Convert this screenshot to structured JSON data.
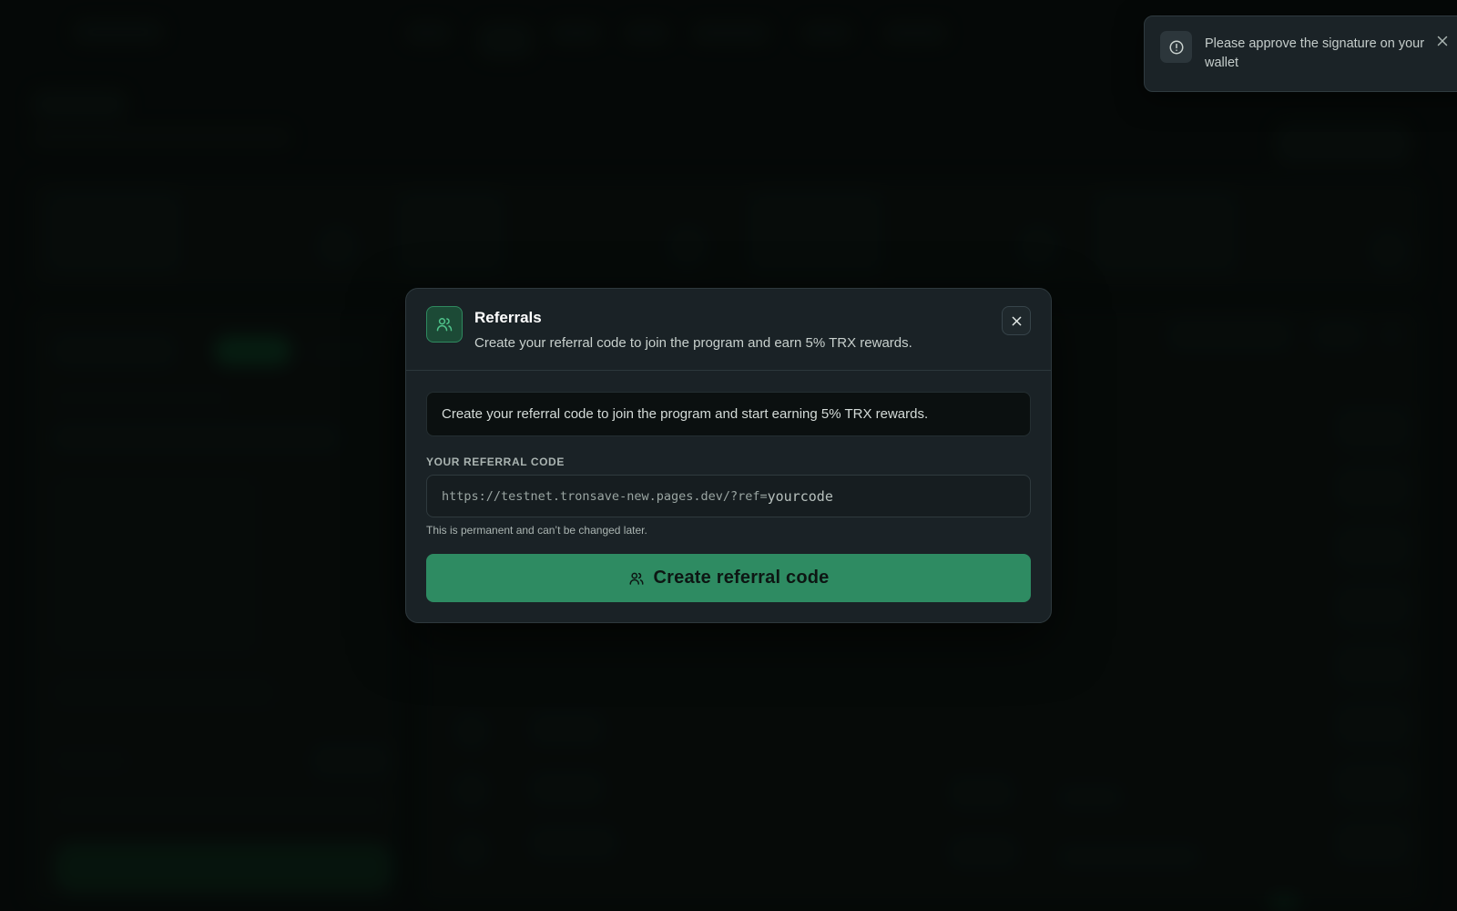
{
  "modal": {
    "title": "Referrals",
    "subtitle": "Create your referral code to join the program and earn 5% TRX rewards.",
    "info_text": "Create your referral code to join the program and start earning 5% TRX rewards.",
    "field_label": "YOUR REFERRAL CODE",
    "input_prefix": "https://testnet.tronsave-new.pages.dev/?ref=",
    "input_placeholder": "yourcode",
    "helper_text": "This is permanent and can’t be changed later.",
    "cta_label": "Create referral code",
    "header_icon": "users-icon",
    "close_icon": "close-icon"
  },
  "toast": {
    "message": "Please approve the signature on your wallet",
    "icon": "alert-circle-icon",
    "close_icon": "close-icon"
  },
  "colors": {
    "accent": "#2e8b62",
    "page_background": "#070b0a",
    "modal_background": "#1a2226"
  }
}
